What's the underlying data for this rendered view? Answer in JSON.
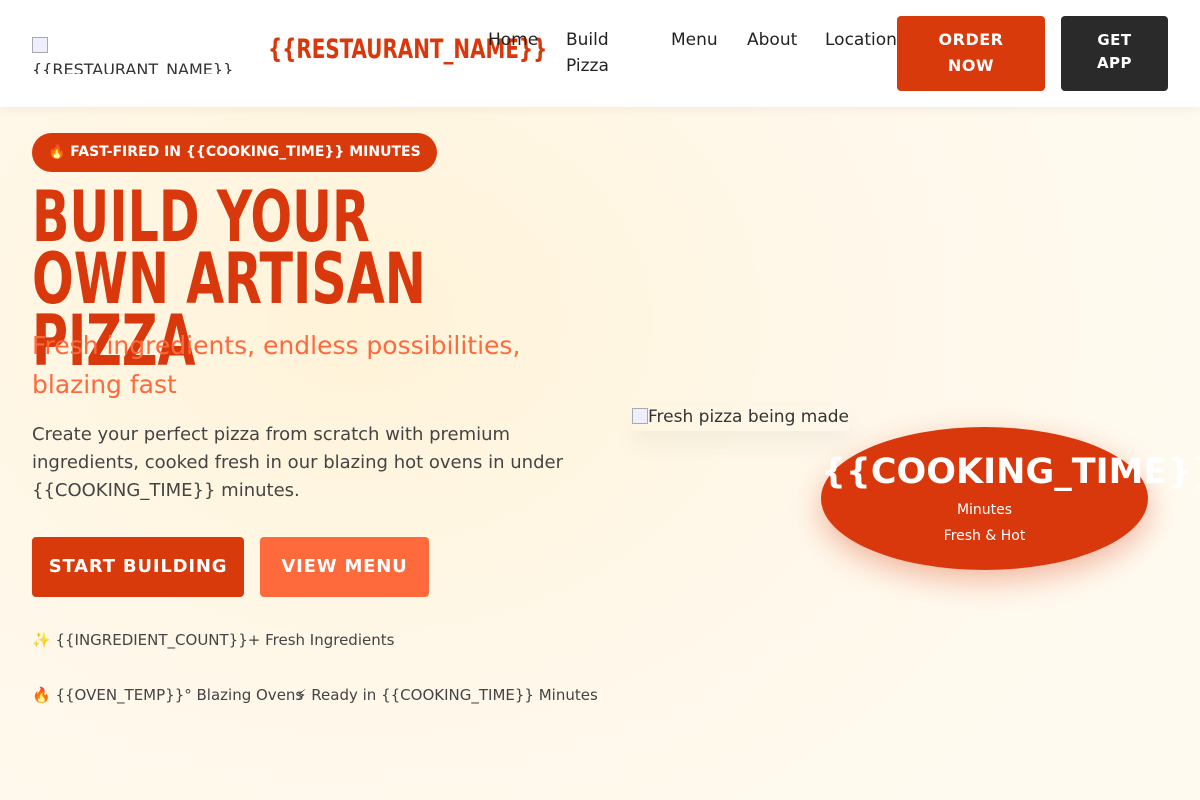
{
  "nav": {
    "logo_alt": "{{RESTAURANT_NAME}} Logo",
    "brand": "{{RESTAURANT_NAME}}",
    "links": [
      "Home",
      "Build Pizza",
      "Menu",
      "About",
      "Locations"
    ],
    "order_label": "ORDER NOW",
    "app_label": "GET APP"
  },
  "hero": {
    "badge": "🔥 FAST-FIRED IN {{COOKING_TIME}} MINUTES",
    "title": "Build Your Own Artisan Pizza",
    "subtitle": "Fresh ingredients, endless possibilities, blazing fast",
    "description": "Create your perfect pizza from scratch with premium ingredients, cooked fresh in our blazing hot ovens in under {{COOKING_TIME}} minutes.",
    "start_label": "START BUILDING",
    "menu_label": "VIEW MENU",
    "features": [
      "✨ {{INGREDIENT_COUNT}}+ Fresh Ingredients",
      "🔥 {{OVEN_TEMP}}° Blazing Ovens",
      "⚡ Ready in {{COOKING_TIME}} Minutes"
    ],
    "image_alt": "Fresh pizza being made",
    "timer": {
      "value": "{{COOKING_TIME}}",
      "unit": "Minutes",
      "note": "Fresh & Hot"
    }
  },
  "colors": {
    "primary": "#d8380b",
    "secondary": "#ff6a3d",
    "dark": "#2a2a2a",
    "background": "#fff8ea"
  }
}
